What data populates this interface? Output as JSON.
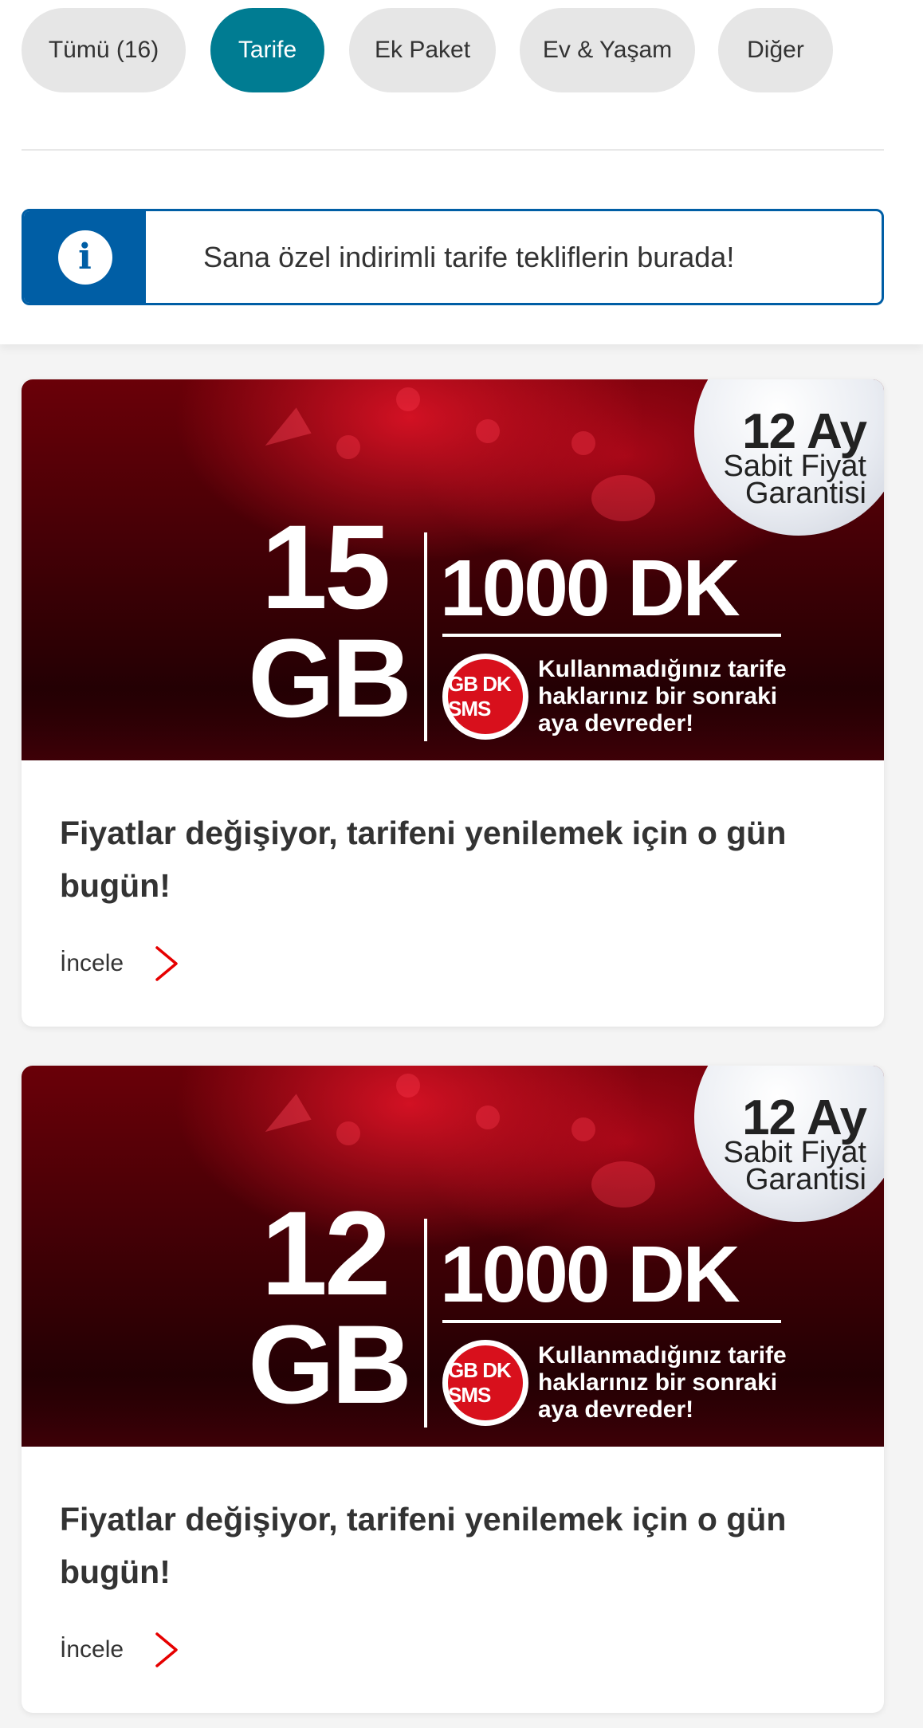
{
  "filters": [
    {
      "label": "Tümü (16)",
      "active": false
    },
    {
      "label": "Tarife",
      "active": true
    },
    {
      "label": "Ek Paket",
      "active": false
    },
    {
      "label": "Ev & Yaşam",
      "active": false
    },
    {
      "label": "Diğer",
      "active": false
    }
  ],
  "info": {
    "icon": "info-icon",
    "text": "Sana özel indirimli tarife tekliflerin burada!"
  },
  "colors": {
    "accent": "#007c92",
    "info_blue": "#005ea5",
    "brand_red": "#e60000"
  },
  "cards": [
    {
      "banner": {
        "badge_line1": "12 Ay",
        "badge_line2": "Sabit Fiyat",
        "badge_line3": "Garantisi",
        "gb_number": "15",
        "gb_unit": "GB",
        "dk": "1000 DK",
        "rollover_icon": "GB DK SMS",
        "rollover_text": "Kullanmadığınız tarife haklarınız bir sonraki aya devreder!"
      },
      "title": "Fiyatlar değişiyor, tarifeni yenilemek için o gün bugün!",
      "link": "İncele"
    },
    {
      "banner": {
        "badge_line1": "12 Ay",
        "badge_line2": "Sabit Fiyat",
        "badge_line3": "Garantisi",
        "gb_number": "12",
        "gb_unit": "GB",
        "dk": "1000 DK",
        "rollover_icon": "GB DK SMS",
        "rollover_text": "Kullanmadığınız tarife haklarınız bir sonraki aya devreder!"
      },
      "title": "Fiyatlar değişiyor, tarifeni yenilemek için o gün bugün!",
      "link": "İncele"
    }
  ]
}
